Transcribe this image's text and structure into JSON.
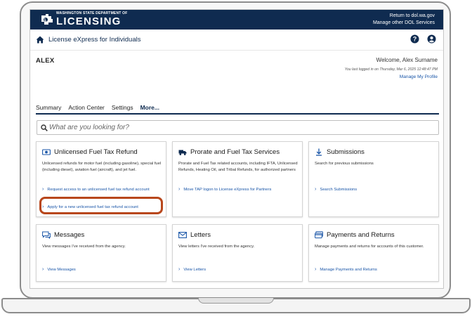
{
  "banner": {
    "logo_small": "WASHINGTON STATE DEPARTMENT OF",
    "logo_big": "LICENSING",
    "link_return": "Return to dol.wa.gov",
    "link_other": "Manage other DOL Services"
  },
  "header": {
    "title": "License eXpress for Individuals"
  },
  "user": {
    "name": "ALEX",
    "welcome": "Welcome, Alex Surname",
    "last_login": "You last logged in on Thursday, Mar 6, 2025 12:48:47 PM",
    "manage_profile": "Manage My Profile"
  },
  "tabs": [
    "Summary",
    "Action Center",
    "Settings",
    "More..."
  ],
  "search": {
    "placeholder": "What are you looking for?"
  },
  "cards": [
    {
      "icon": "cash-icon",
      "title": "Unlicensed Fuel Tax Refund",
      "desc": "Unlicensed refunds for motor fuel (including gasoline), special fuel (including diesel), aviation fuel (aircraft), and jet fuel.",
      "links": [
        "Request access to an unlicensed fuel tax refund account",
        "Apply for a new unlicensed fuel tax refund account"
      ]
    },
    {
      "icon": "truck-icon",
      "title": "Prorate and Fuel Tax Services",
      "desc": "Prorate and Fuel Tax related accounts, including IFTA, Unlicensed Refunds, Heating Oil, and Tribal Refunds, for authorized partners",
      "links": [
        "Move TAP logon to License eXpress for Partners"
      ]
    },
    {
      "icon": "download-icon",
      "title": "Submissions",
      "desc": "Search for previous submissions",
      "links": [
        "Search Submissions"
      ]
    },
    {
      "icon": "messages-icon",
      "title": "Messages",
      "desc": "View messages I've received from the agency.",
      "links": [
        "View Messages"
      ]
    },
    {
      "icon": "envelope-icon",
      "title": "Letters",
      "desc": "View letters I've received from the agency.",
      "links": [
        "View Letters"
      ]
    },
    {
      "icon": "payment-card-icon",
      "title": "Payments and Returns",
      "desc": "Manage payments and returns for accounts of this customer.",
      "links": [
        "Manage Payments and Returns"
      ]
    }
  ],
  "colors": {
    "navy": "#0f2b50",
    "link_blue": "#1a56a8",
    "highlight": "#b8471c"
  }
}
